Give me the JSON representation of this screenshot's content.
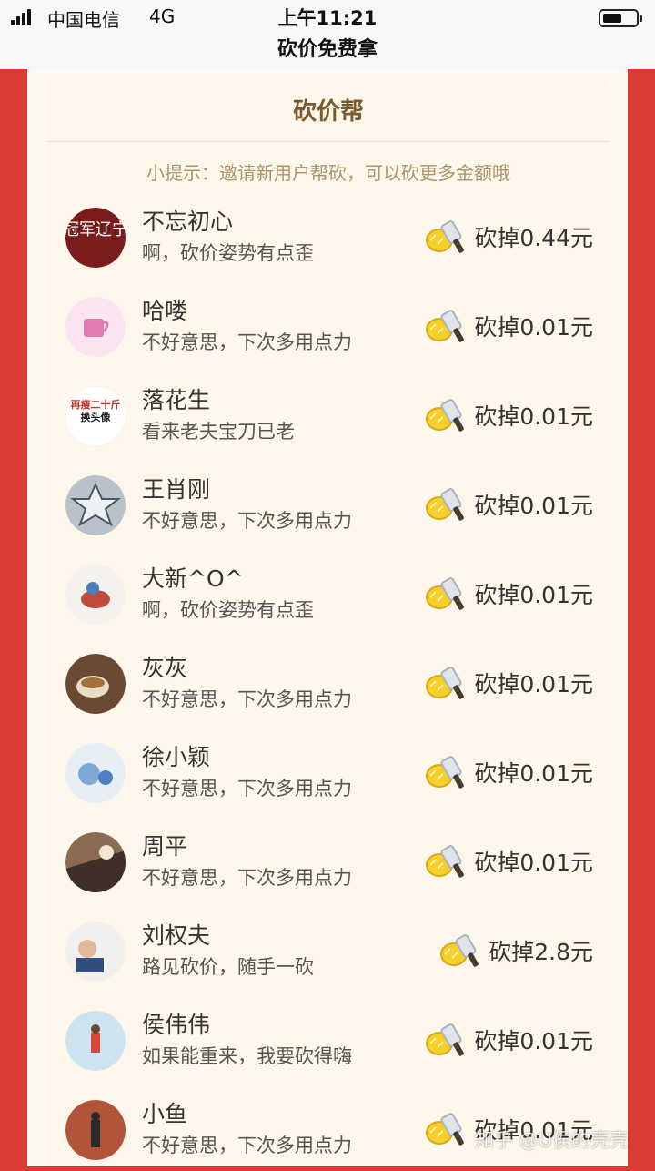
{
  "status_bar": {
    "carrier": "中国电信",
    "network": "4G",
    "time": "上午11:21",
    "page_title": "砍价免费拿"
  },
  "card": {
    "title": "砍价帮",
    "tip": "小提示：邀请新用户帮砍，可以砍更多金额哦"
  },
  "helpers": [
    {
      "name": "不忘初心",
      "message": "啊，砍价姿势有点歪",
      "amount": "砍掉0.44元"
    },
    {
      "name": "哈喽",
      "message": "不好意思，下次多用点力",
      "amount": "砍掉0.01元"
    },
    {
      "name": "落花生",
      "message": "看来老夫宝刀已老",
      "amount": "砍掉0.01元"
    },
    {
      "name": "王肖刚",
      "message": "不好意思，下次多用点力",
      "amount": "砍掉0.01元"
    },
    {
      "name": "大新^O^",
      "message": "啊，砍价姿势有点歪",
      "amount": "砍掉0.01元"
    },
    {
      "name": "灰灰",
      "message": "不好意思，下次多用点力",
      "amount": "砍掉0.01元"
    },
    {
      "name": "徐小颖",
      "message": "不好意思，下次多用点力",
      "amount": "砍掉0.01元"
    },
    {
      "name": "周平",
      "message": "不好意思，下次多用点力",
      "amount": "砍掉0.01元"
    },
    {
      "name": "刘权夫",
      "message": "路见砍价，随手一砍",
      "amount": "砍掉2.8元"
    },
    {
      "name": "侯伟伟",
      "message": "如果能重来，我要砍得嗨",
      "amount": "砍掉0.01元"
    },
    {
      "name": "小鱼",
      "message": "不好意思，下次多用点力",
      "amount": "砍掉0.01元"
    }
  ],
  "avatar_texts": {
    "a1": "冠军辽宁",
    "a3_line1": "再瘦二十斤",
    "a3_line2": "换头像"
  },
  "watermark": "知乎 @U侯的壳壳",
  "colors": {
    "background_red": "#d93b35",
    "card_bg": "#fcf7ea",
    "title_brown": "#7a5a2e",
    "tip_tan": "#a8946b"
  }
}
